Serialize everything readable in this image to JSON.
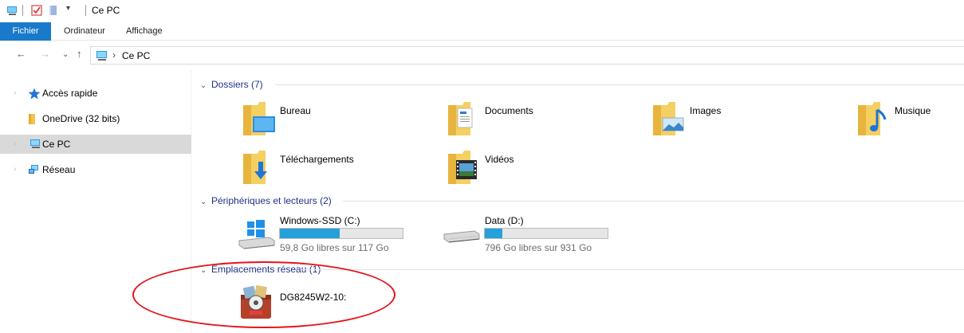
{
  "window": {
    "title": "Ce PC"
  },
  "quick_access_toolbar": {
    "icons": [
      "this-pc-icon",
      "properties-check-icon",
      "new-folder-icon",
      "qat-dropdown-icon"
    ]
  },
  "ribbon": {
    "tabs": [
      {
        "label": "Fichier"
      },
      {
        "label": "Ordinateur"
      },
      {
        "label": "Affichage"
      }
    ]
  },
  "address": {
    "path": "Ce PC"
  },
  "sidebar": {
    "items": [
      {
        "label": "Accès rapide",
        "icon": "star-icon",
        "selected": false
      },
      {
        "label": "OneDrive (32 bits)",
        "icon": "onedrive-folder-icon",
        "selected": false
      },
      {
        "label": "Ce PC",
        "icon": "this-pc-icon",
        "selected": true
      },
      {
        "label": "Réseau",
        "icon": "network-icon",
        "selected": false
      }
    ]
  },
  "groups": {
    "folders": {
      "header": "Dossiers (7)",
      "items": [
        {
          "label": "Bureau",
          "icon": "desktop-folder-icon"
        },
        {
          "label": "Documents",
          "icon": "documents-folder-icon"
        },
        {
          "label": "Images",
          "icon": "pictures-folder-icon"
        },
        {
          "label": "Musique",
          "icon": "music-folder-icon"
        },
        {
          "label": "Téléchargements",
          "icon": "downloads-folder-icon"
        },
        {
          "label": "Vidéos",
          "icon": "videos-folder-icon"
        }
      ]
    },
    "devices": {
      "header": "Périphériques et lecteurs (2)",
      "drives": [
        {
          "label": "Windows-SSD (C:)",
          "free_text": "59,8 Go libres sur 117 Go",
          "used_fraction": 0.49,
          "icon": "windows-drive-icon"
        },
        {
          "label": "Data (D:)",
          "free_text": "796 Go libres sur 931 Go",
          "used_fraction": 0.145,
          "icon": "hard-drive-icon"
        }
      ]
    },
    "network": {
      "header": "Emplacements réseau (1)",
      "items": [
        {
          "label": "DG8245W2-10:",
          "icon": "media-server-icon"
        }
      ]
    }
  },
  "colors": {
    "accent": "#1979ca",
    "drive_fill": "#26a0da",
    "annotation": "#e4151b",
    "group_header": "#1e3287"
  }
}
